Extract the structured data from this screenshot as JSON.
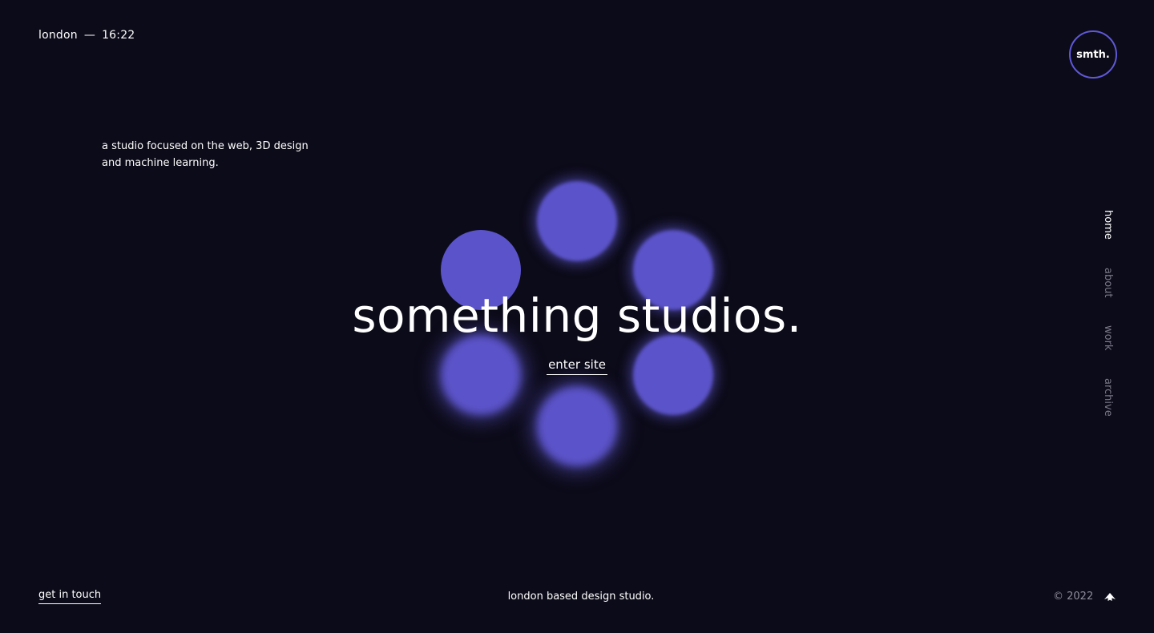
{
  "header": {
    "city": "london",
    "separator": "—",
    "time": "16:22",
    "logo_text": "smth."
  },
  "intro": {
    "tagline_line1": "a studio focused on the web, 3D design",
    "tagline_line2": "and machine learning."
  },
  "hero": {
    "title": "something studios.",
    "cta_label": "enter site"
  },
  "nav": {
    "items": [
      {
        "label": "home",
        "active": true
      },
      {
        "label": "about",
        "active": false
      },
      {
        "label": "work",
        "active": false
      },
      {
        "label": "archive",
        "active": false
      }
    ]
  },
  "footer": {
    "contact_label": "get in touch",
    "tagline": "london based design studio.",
    "copyright": "© 2022",
    "top_icon": "arrow-up-icon"
  },
  "colors": {
    "background": "#0c0b19",
    "accent": "#5b53c9",
    "logo_ring": "#5f58d6",
    "text": "#ffffff",
    "muted": "#7a7888"
  }
}
